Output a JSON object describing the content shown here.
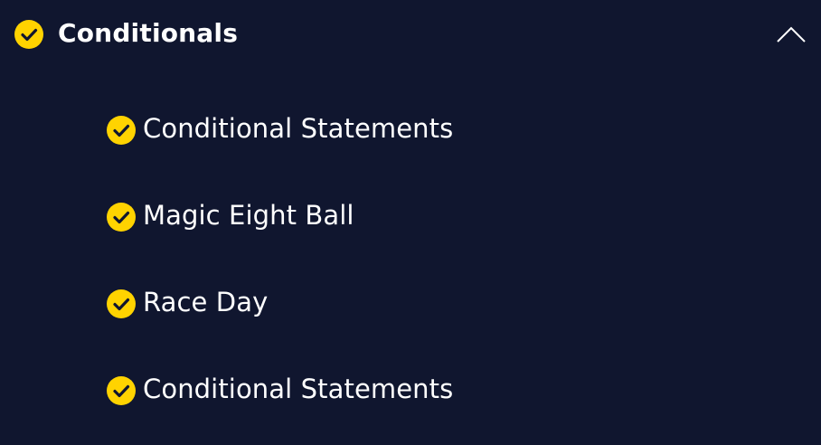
{
  "colors": {
    "background": "#10162f",
    "accent_yellow": "#ffd300",
    "text": "#ffffff",
    "check_mark": "#10162f"
  },
  "section": {
    "title": "Conditionals",
    "status_icon": "check-circle-icon",
    "toggle_icon": "chevron-up-icon",
    "expanded": true
  },
  "lessons": [
    {
      "label": "Conditional Statements",
      "icon": "check-circle-icon",
      "completed": true
    },
    {
      "label": "Magic Eight Ball",
      "icon": "check-circle-icon",
      "completed": true
    },
    {
      "label": "Race Day",
      "icon": "check-circle-icon",
      "completed": true
    },
    {
      "label": "Conditional Statements",
      "icon": "check-circle-icon",
      "completed": true
    }
  ]
}
